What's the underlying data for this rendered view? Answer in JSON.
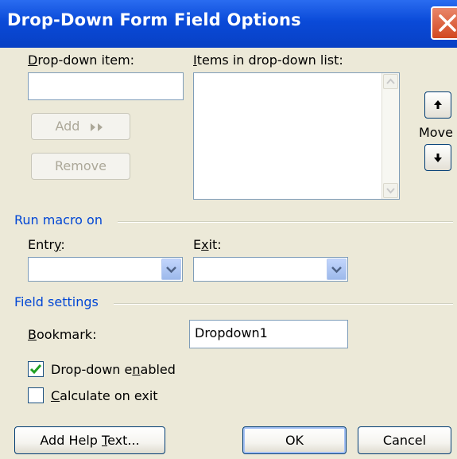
{
  "window": {
    "title": "Drop-Down Form Field Options"
  },
  "dropdown_item": {
    "label_u": "D",
    "label_rest": "rop-down item:",
    "value": ""
  },
  "items_list": {
    "label_u": "I",
    "label_rest": "tems in drop-down list:",
    "items": []
  },
  "buttons": {
    "add_label": "Add",
    "remove_label": "Remove",
    "move_label": "Move"
  },
  "run_macro": {
    "title": "Run macro on",
    "entry_label_pre": "Entr",
    "entry_label_u": "y",
    "entry_label_post": ":",
    "entry_value": "",
    "exit_label_pre": "E",
    "exit_label_u": "x",
    "exit_label_post": "it:",
    "exit_value": ""
  },
  "field_settings": {
    "title": "Field settings",
    "bookmark_label_u": "B",
    "bookmark_label_rest": "ookmark:",
    "bookmark_value": "Dropdown1",
    "dropdown_enabled_pre": "Drop-down e",
    "dropdown_enabled_u": "n",
    "dropdown_enabled_post": "abled",
    "dropdown_enabled_checked": true,
    "calculate_u": "C",
    "calculate_rest": "alculate on exit",
    "calculate_checked": false
  },
  "footer": {
    "help_pre": "Add Help ",
    "help_u": "T",
    "help_post": "ext...",
    "ok_label": "OK",
    "cancel_label": "Cancel"
  }
}
